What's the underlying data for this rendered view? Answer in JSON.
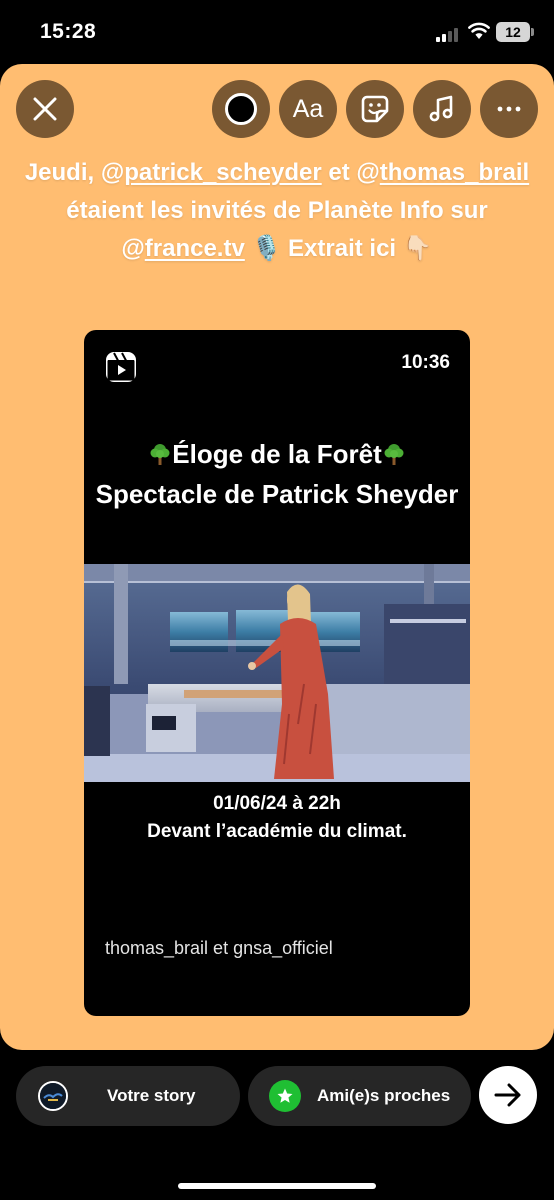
{
  "status_bar": {
    "time": "15:28",
    "battery": "12"
  },
  "story_toolbar": {
    "close_icon": "close-icon",
    "color_icon": "color-picker-icon",
    "text_label": "Aa",
    "sticker_icon": "sticker-icon",
    "music_icon": "music-note-icon",
    "more_icon": "more-icon"
  },
  "caption": {
    "part1": "Jeudi, @",
    "mention1": "patrick_scheyder",
    "part2": " et @",
    "mention2": "thomas_brail",
    "part3": " étaient les invités de Planète Info sur @",
    "mention3": "france.tv",
    "part4": " 🎙️ Extrait ici 👇🏻"
  },
  "reel": {
    "duration": "10:36",
    "title_line1": "Éloge de la Forêt",
    "title_line2": "Spectacle de Patrick Sheyder",
    "date": "01/06/24 à 22h",
    "place": "Devant l’académie du climat.",
    "author": "thomas_brail et gnsa_officiel"
  },
  "bottom": {
    "your_story": "Votre story",
    "close_friends": "Ami(e)s proches",
    "send_icon": "arrow-right-icon"
  },
  "colors": {
    "canvas_bg": "#ffbd71",
    "toolbar_button_bg": "#7a5832",
    "pill_bg": "#262626",
    "close_friends_green": "#1fbf33"
  }
}
